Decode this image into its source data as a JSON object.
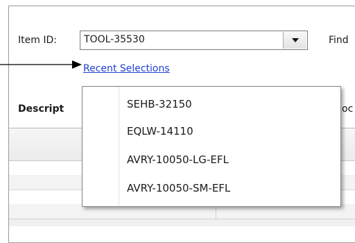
{
  "form": {
    "item_id_label": "Item ID:",
    "item_id_value": "TOOL-35530",
    "find_label": "Find",
    "recent_link": "Recent Selections",
    "description_label": "Descript",
    "right_partial_label": "oc"
  },
  "recent_dropdown": {
    "items": [
      {
        "label": "SEHB-32150"
      },
      {
        "label": "EQLW-14110"
      },
      {
        "label": "AVRY-10050-LG-EFL"
      },
      {
        "label": "AVRY-10050-SM-EFL"
      }
    ]
  },
  "icons": {
    "combo_arrow": "chevron-down-icon",
    "pointer_arrow": "callout-arrow-icon"
  },
  "colors": {
    "link": "#1f3fd4",
    "border": "#9a9a9a"
  }
}
